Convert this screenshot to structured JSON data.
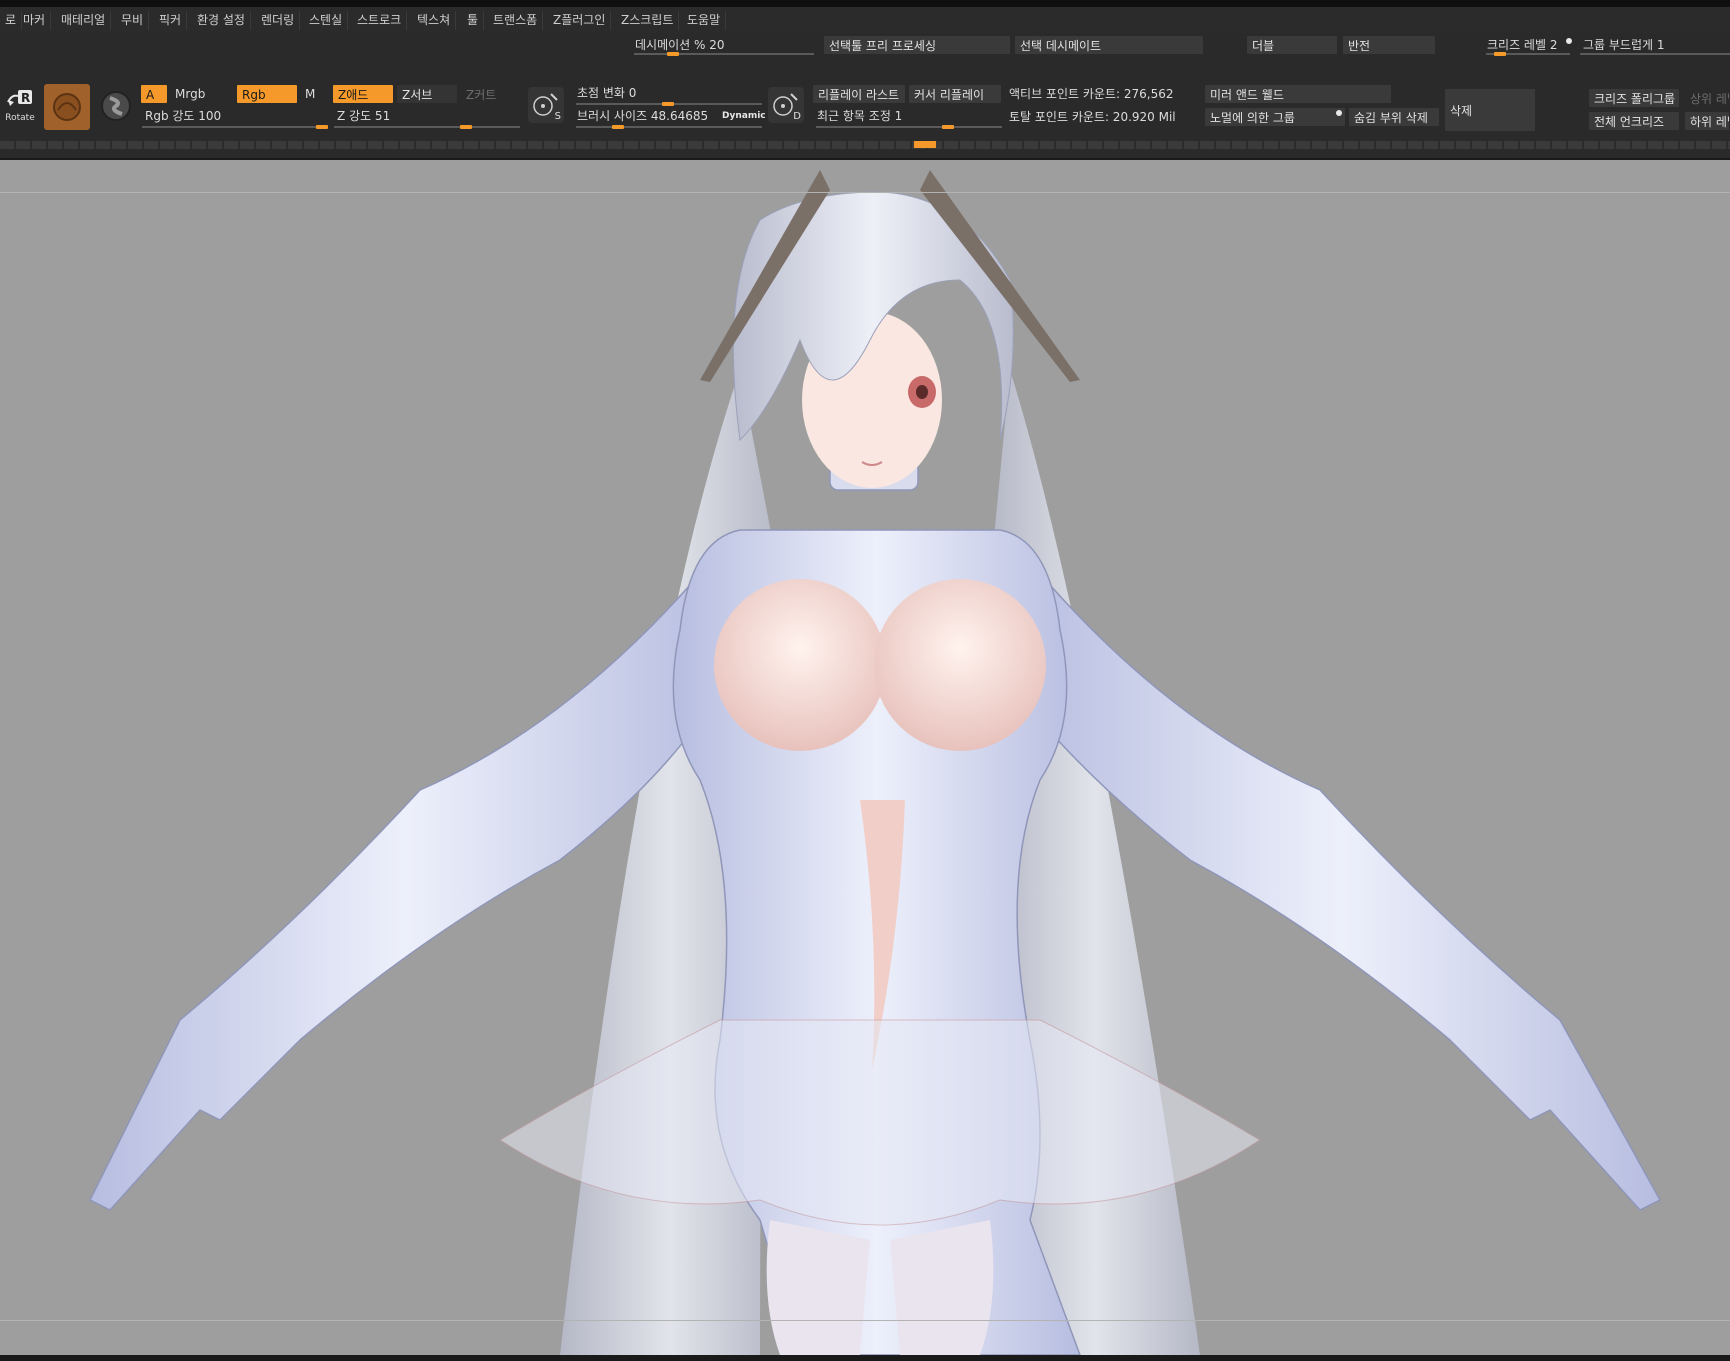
{
  "menu": [
    "로",
    "마커",
    "매테리얼",
    "무비",
    "픽커",
    "환경 설정",
    "렌더링",
    "스텐실",
    "스트로크",
    "텍스쳐",
    "툴",
    "트랜스폼",
    "Z플러그인",
    "Z스크립트",
    "도움말"
  ],
  "toolbar": {
    "decimation": "데시메이션 % 20",
    "selection_preprocess": "선택툴 프리 프로세싱",
    "selection_decimate": "선택 데시메이트",
    "double": "더블",
    "flip": "반전",
    "crease_level": "크리즈 레벨 2",
    "group_smooth": "그룹 부드럽게 1",
    "rotate_label": "Rotate",
    "btn_a": "A",
    "btn_mrgb": "Mrgb",
    "btn_rgb": "Rgb",
    "btn_m": "M",
    "btn_zadd": "Z애드",
    "btn_zsub": "Z서브",
    "btn_zcut": "Z커트",
    "rgb_intensity": "Rgb 강도 100",
    "z_intensity": "Z 강도 51",
    "focal_shift": "초점 변화 0",
    "brush_size": "브러시 사이즈 48.64685",
    "dynamic": "Dynamic",
    "s_letter": "S",
    "d_letter": "D",
    "replay_last": "리플레이 라스트",
    "cursor_replay": "커서 리플레이",
    "recent_adjust": "최근 항목 조정 1",
    "active_points": "액티브 포인트 카운트: 276,562",
    "total_points": "토탈 포인트 카운트: 20.920 Mil",
    "mirror_weld": "미러 앤드 웰드",
    "group_by_normals": "노멀에 의한 그룹",
    "delete_hidden": "숨김 부위 삭제",
    "delete": "삭제",
    "crease_polygroups": "크리즈 폴리그룹",
    "uncrease_all": "전체 언크리즈",
    "upper_level": "상위 레벨",
    "lower_level": "하위 레벨"
  },
  "colors": {
    "accent": "#f59a2a",
    "viewport_bg": "#9e9e9e",
    "ui_bg": "#2a2a2a",
    "suit": "#dfe3f5",
    "skin": "#f3d6d0"
  },
  "icons": [
    "rotate-icon",
    "material-sphere-icon",
    "brush-alpha-icon",
    "symmetry-s-icon",
    "symmetry-d-icon"
  ]
}
